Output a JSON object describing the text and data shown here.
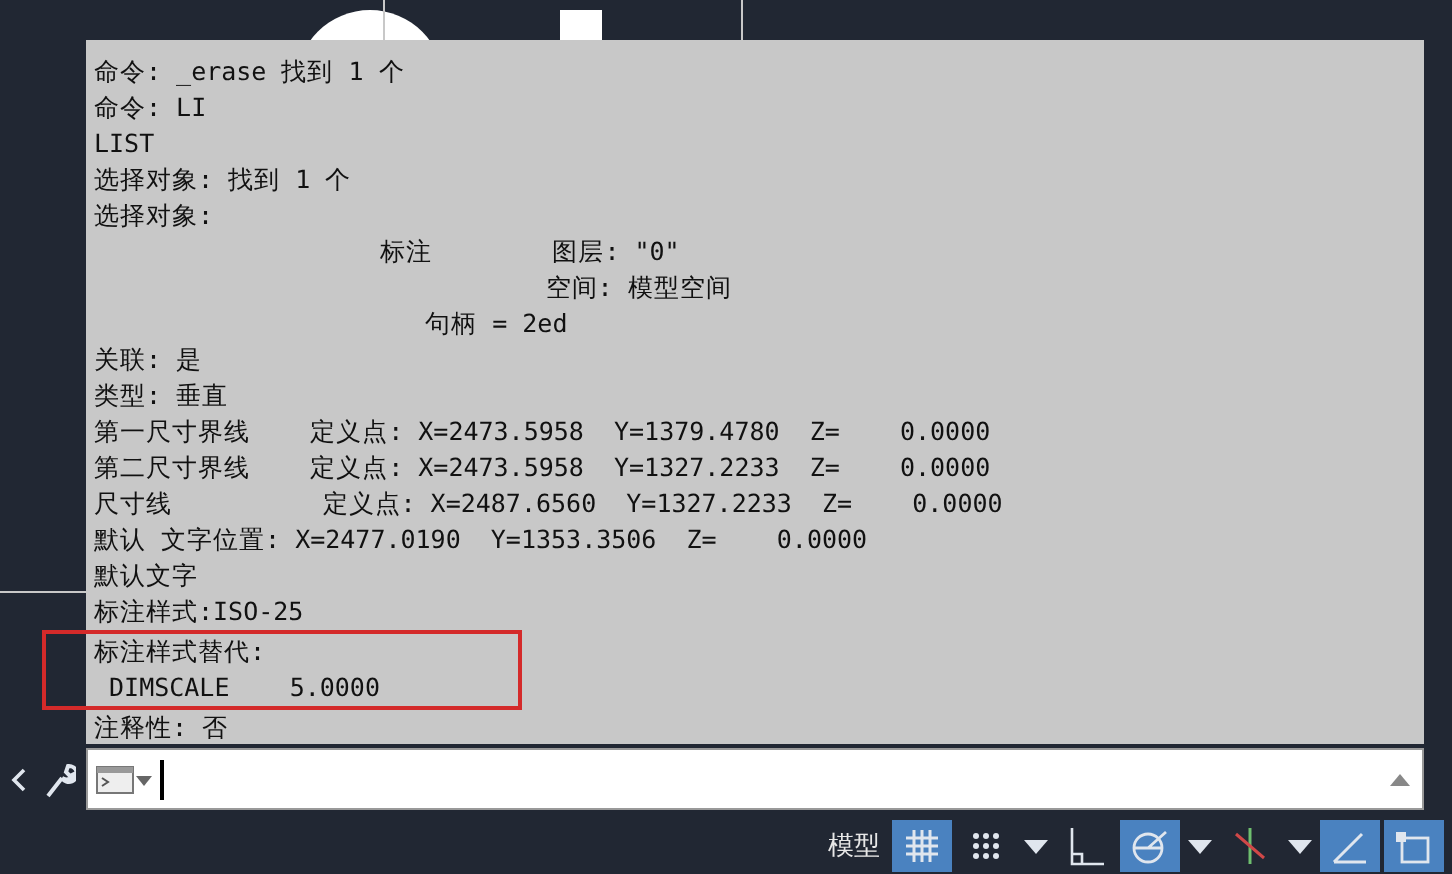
{
  "history": [
    {
      "text": "命令: _erase 找到 1 个",
      "highlighted": false
    },
    {
      "text": "命令: LI",
      "highlighted": false
    },
    {
      "text": "LIST",
      "highlighted": false
    },
    {
      "text": "选择对象: 找到 1 个",
      "highlighted": false
    },
    {
      "text": "选择对象:",
      "highlighted": false
    },
    {
      "text": "                   标注        图层: \"0\"",
      "highlighted": false
    },
    {
      "text": "                              空间: 模型空间",
      "highlighted": false
    },
    {
      "text": "                      句柄 = 2ed",
      "highlighted": false
    },
    {
      "text": "关联: 是",
      "highlighted": false
    },
    {
      "text": "类型: 垂直",
      "highlighted": false
    },
    {
      "text": "第一尺寸界线    定义点: X=2473.5958  Y=1379.4780  Z=    0.0000",
      "highlighted": false
    },
    {
      "text": "第二尺寸界线    定义点: X=2473.5958  Y=1327.2233  Z=    0.0000",
      "highlighted": false
    },
    {
      "text": "尺寸线          定义点: X=2487.6560  Y=1327.2233  Z=    0.0000",
      "highlighted": false
    },
    {
      "text": "默认 文字位置: X=2477.0190  Y=1353.3506  Z=    0.0000",
      "highlighted": false
    },
    {
      "text": "默认文字",
      "highlighted": false
    },
    {
      "text": "标注样式:ISO-25",
      "highlighted": false
    },
    {
      "text": "标注样式替代:",
      "highlighted": true
    },
    {
      "text": " DIMSCALE    5.0000",
      "highlighted": true
    },
    {
      "text": "注释性: 否",
      "highlighted": false
    }
  ],
  "status_bar": {
    "label": "模型",
    "tools": [
      {
        "kind": "grid",
        "selected": true
      },
      {
        "kind": "snap",
        "selected": false
      },
      {
        "kind": "caret",
        "selected": false
      },
      {
        "kind": "ortho",
        "selected": false
      },
      {
        "kind": "polar",
        "selected": true
      },
      {
        "kind": "caret",
        "selected": false
      },
      {
        "kind": "osnap",
        "selected": false
      },
      {
        "kind": "caret",
        "selected": false
      },
      {
        "kind": "angle",
        "selected": true
      },
      {
        "kind": "frame",
        "selected": true
      }
    ]
  }
}
